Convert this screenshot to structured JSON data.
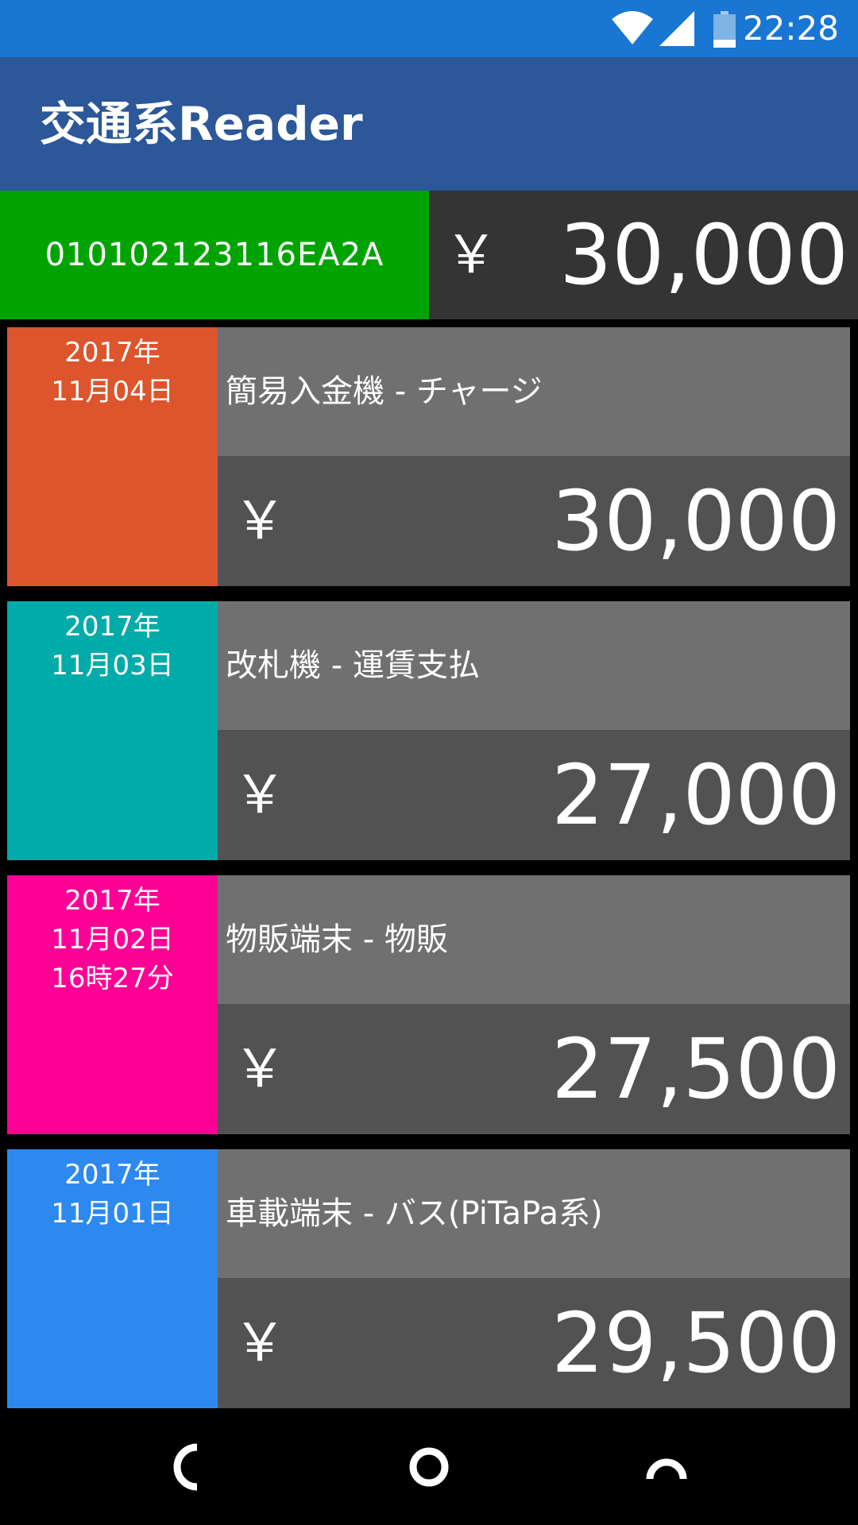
{
  "status_bar": {
    "time": "22:28",
    "icons": [
      "wifi-icon",
      "signal-icon",
      "battery-icon"
    ],
    "color": "#1976d2"
  },
  "app_bar": {
    "title": "交通系Reader",
    "color": "#2c5799"
  },
  "card": {
    "id": "010102123116EA2A",
    "currency": "￥",
    "balance": "30,000",
    "id_color": "#00a300",
    "balance_color": "#343434"
  },
  "history": [
    {
      "date_lines": [
        "2017年",
        "11月04日"
      ],
      "description": "簡易入金機 - チャージ",
      "currency": "￥",
      "amount": "30,000",
      "color": "#dc552c"
    },
    {
      "date_lines": [
        "2017年",
        "11月03日"
      ],
      "description": "改札機 - 運賃支払",
      "currency": "￥",
      "amount": "27,000",
      "color": "#00aba9"
    },
    {
      "date_lines": [
        "2017年",
        "11月02日",
        "16時27分"
      ],
      "description": "物販端末 - 物販",
      "currency": "￥",
      "amount": "27,500",
      "color": "#ff0097"
    },
    {
      "date_lines": [
        "2017年",
        "11月01日"
      ],
      "description": "車載端末 - バス(PiTaPa系)",
      "currency": "￥",
      "amount": "29,500",
      "color": "#2d89ef"
    }
  ],
  "nav_bar": {
    "icons": [
      "back-icon",
      "home-icon",
      "recents-icon"
    ]
  }
}
